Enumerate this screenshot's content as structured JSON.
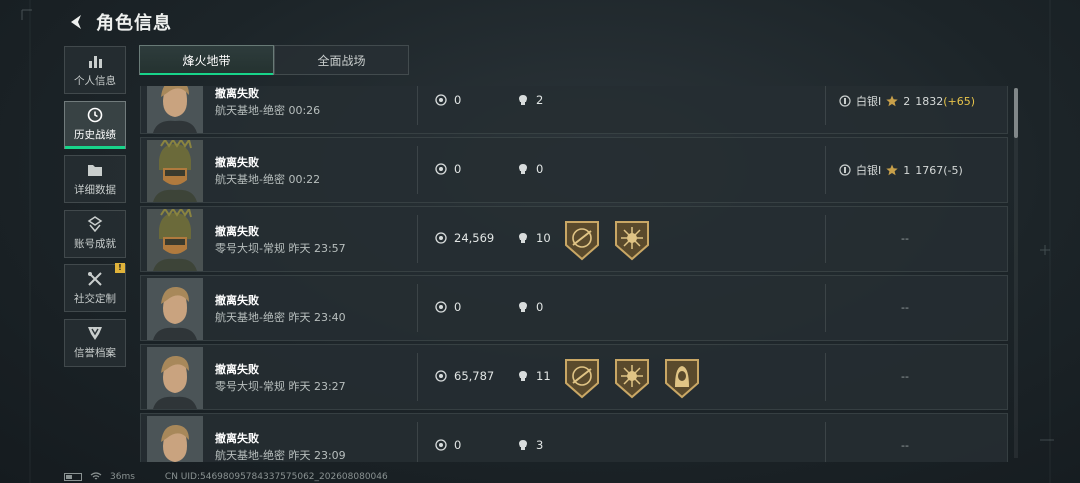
{
  "header": {
    "title": "角色信息",
    "back_icon": "back-arrow-icon"
  },
  "sidebar": {
    "items": [
      {
        "label": "个人信息",
        "icon": "bar-chart-icon"
      },
      {
        "label": "历史战绩",
        "icon": "clock-history-icon"
      },
      {
        "label": "详细数据",
        "icon": "folder-icon"
      },
      {
        "label": "账号成就",
        "icon": "achievement-icon"
      },
      {
        "label": "社交定制",
        "icon": "tools-icon",
        "badge": "!"
      },
      {
        "label": "信誉档案",
        "icon": "shield-badge-icon"
      }
    ],
    "active_index": 1
  },
  "tabs": [
    {
      "label": "烽火地带"
    },
    {
      "label": "全面战场"
    }
  ],
  "rows": [
    {
      "result": "撤离失败",
      "map_time": "航天基地-绝密 00:26",
      "value": "0",
      "kills": "2",
      "rank_name": "白银I",
      "rank_stars": "2",
      "score": "1832",
      "delta": "(+65)",
      "avatar": "operator-portrait-blond"
    },
    {
      "result": "撤离失败",
      "map_time": "航天基地-绝密 00:22",
      "value": "0",
      "kills": "0",
      "rank_name": "白银I",
      "rank_stars": "1",
      "score": "1767(-5)",
      "avatar": "operator-portrait-helmet"
    },
    {
      "result": "撤离失败",
      "map_time": "零号大坝-常规 昨天 23:57",
      "value": "24,569",
      "kills": "10",
      "medals": [
        "rifle-medal-icon",
        "sun-medal-icon"
      ],
      "dash": "--",
      "avatar": "operator-portrait-helmet"
    },
    {
      "result": "撤离失败",
      "map_time": "航天基地-绝密 昨天 23:40",
      "value": "0",
      "kills": "0",
      "dash": "--",
      "avatar": "operator-portrait-blond"
    },
    {
      "result": "撤离失败",
      "map_time": "零号大坝-常规 昨天 23:27",
      "value": "65,787",
      "kills": "11",
      "medals": [
        "rifle-medal-icon",
        "sun-medal-icon",
        "hooded-medal-icon"
      ],
      "dash": "--",
      "avatar": "operator-portrait-blond"
    },
    {
      "result": "撤离失败",
      "map_time": "航天基地-绝密 昨天 23:09",
      "value": "0",
      "kills": "3",
      "dash": "--",
      "avatar": "operator-portrait-blond"
    }
  ],
  "footer": {
    "ping": "36ms",
    "uid": "CN UID:5469809578433757506​2_202608080046"
  },
  "colors": {
    "accent": "#18d48a",
    "gold": "#e6c34a"
  }
}
